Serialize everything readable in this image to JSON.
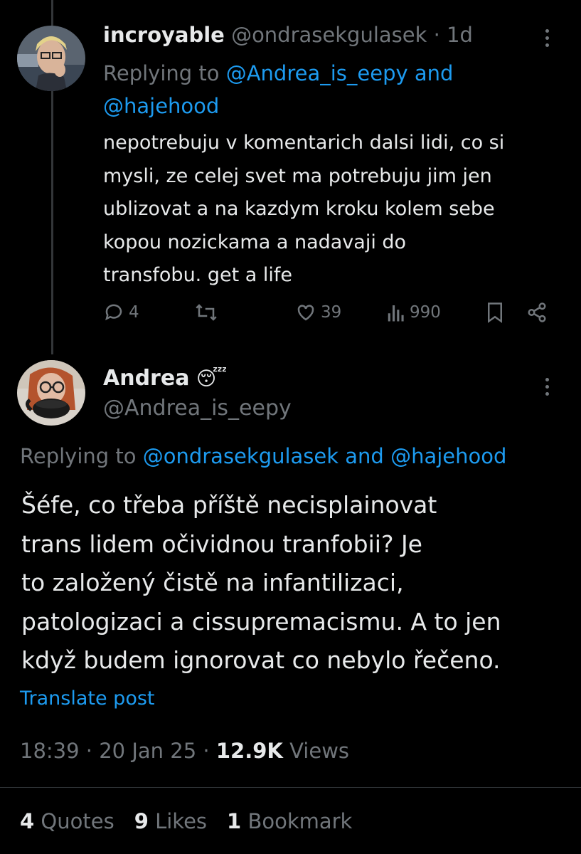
{
  "reply_tweet": {
    "display_name": "incroyable",
    "handle": "@ondrasekgulasek",
    "separator": "·",
    "time_ago": "1d",
    "replying_prefix": "Replying to",
    "replying_user1": "@Andrea_is_eepy",
    "replying_and": "and",
    "replying_user2": "@hajehood",
    "text_lines": [
      "nepotrebuju v komentarich dalsi lidi, co si",
      "mysli, ze celej svet ma potrebuju jim jen",
      "ublizovat a na kazdym kroku kolem sebe",
      "kopou nozickama a nadavaji do",
      "transfobu. get a life"
    ],
    "actions": {
      "replies": "4",
      "likes": "39",
      "views": "990"
    },
    "icons": [
      "reply-icon",
      "retweet-icon",
      "like-icon",
      "views-icon",
      "bookmark-icon",
      "share-icon",
      "more-icon"
    ]
  },
  "main_tweet": {
    "display_name": "Andrea",
    "name_emoji": "😴",
    "handle": "@Andrea_is_eepy",
    "replying_prefix": "Replying to",
    "replying_user1": "@ondrasekgulasek",
    "replying_and": "and",
    "replying_user2": "@hajehood",
    "text_lines": [
      "Šéfe, co třeba příště necisplainovat",
      "trans lidem očividnou tranfobii? Je",
      "to založený čistě na infantilizaci,",
      "patologizaci a cissupremacismu. A to jen",
      "když budem ignorovat co nebylo řečeno."
    ],
    "translate_label": "Translate post",
    "timestamp_time": "18:39",
    "timestamp_sep1": "·",
    "timestamp_date": "20 Jan 25",
    "timestamp_sep2": "·",
    "views_count": "12.9K",
    "views_label": "Views",
    "stats": {
      "quotes_count": "4",
      "quotes_label": "Quotes",
      "likes_count": "9",
      "likes_label": "Likes",
      "bookmarks_count": "1",
      "bookmarks_label": "Bookmark"
    }
  },
  "colors": {
    "background": "#000000",
    "text": "#e7e9ea",
    "muted": "#71767b",
    "link": "#1d9bf0",
    "divider": "#2f3336"
  }
}
